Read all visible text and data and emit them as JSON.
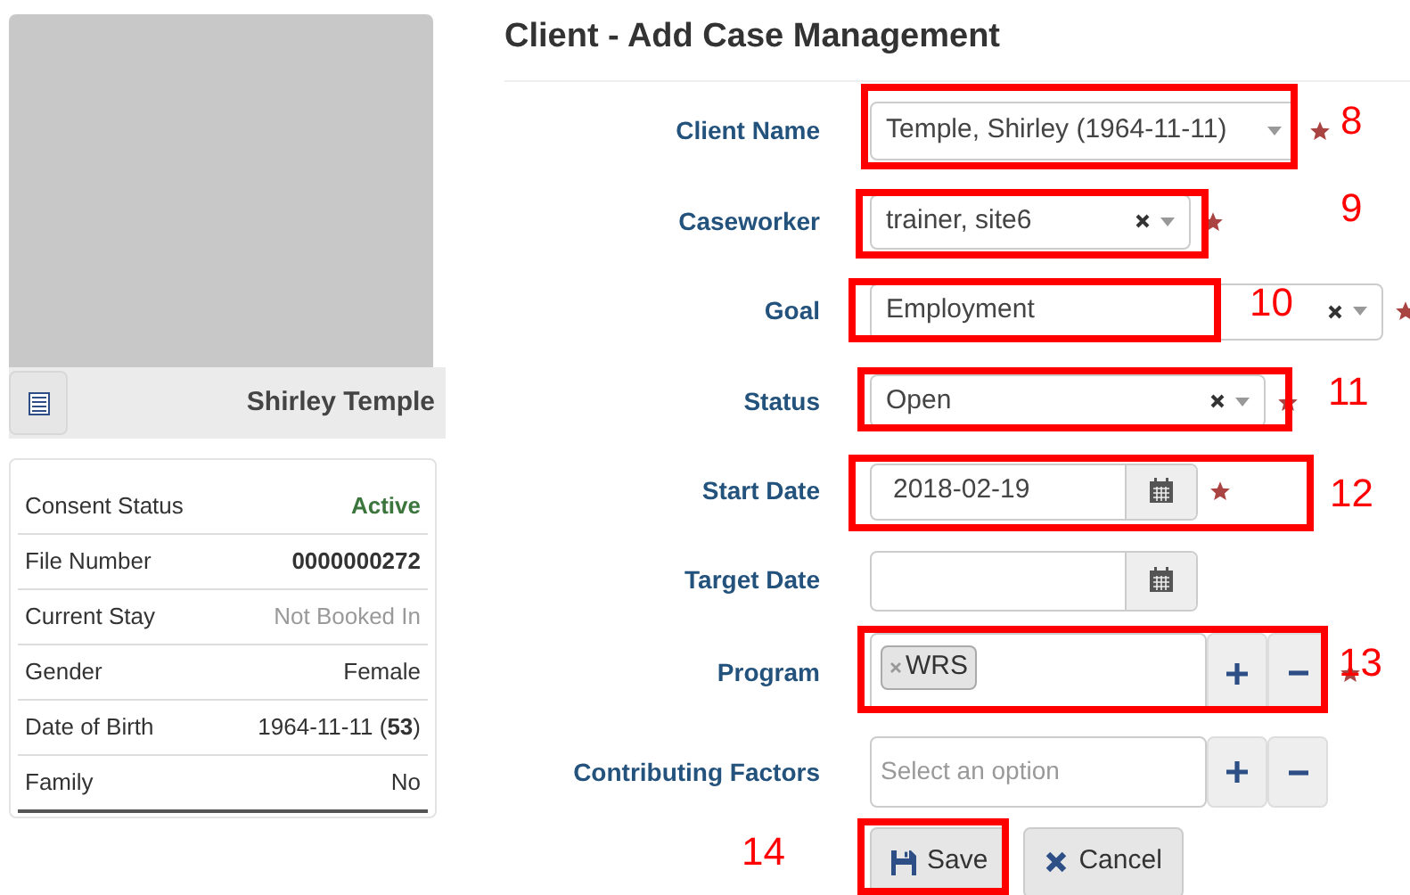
{
  "client_card": {
    "name": "Shirley Temple"
  },
  "info": [
    {
      "label": "Consent Status",
      "value": "Active",
      "kind": "success"
    },
    {
      "label": "File Number",
      "value": "0000000272",
      "kind": "bold"
    },
    {
      "label": "Current Stay",
      "value": "Not Booked In",
      "kind": "muted"
    },
    {
      "label": "Gender",
      "value": "Female",
      "kind": "plain"
    },
    {
      "label": "Date of Birth",
      "value": "1964-11-11 (**53**)",
      "kind": "plain"
    },
    {
      "label": "Family",
      "value": "No",
      "kind": "plain"
    }
  ],
  "title": "Client - Add Case Management",
  "fields": [
    {
      "label": "Client Name",
      "kind": "select",
      "value": "Temple, Shirley (1964-11-11)",
      "clearable": false,
      "required": true
    },
    {
      "label": "Caseworker",
      "kind": "select",
      "value": "trainer, site6",
      "clearable": true,
      "required": true
    },
    {
      "label": "Goal",
      "kind": "select",
      "value": "Employment",
      "clearable": true,
      "required": true
    },
    {
      "label": "Status",
      "kind": "select",
      "value": "Open",
      "clearable": true,
      "required": true
    },
    {
      "label": "Start Date",
      "kind": "date",
      "value": "2018-02-19",
      "required": true
    },
    {
      "label": "Target Date",
      "kind": "date",
      "required": false
    },
    {
      "label": "Program",
      "kind": "multi",
      "tags": [
        "WRS"
      ],
      "required": true
    },
    {
      "label": "Contributing Factors",
      "kind": "multi",
      "placeholder": "Select an option",
      "required": false
    }
  ],
  "buttons": [
    {
      "label": "Save",
      "kind": "save"
    },
    {
      "label": "Cancel",
      "kind": "cancel"
    }
  ],
  "annotations": [
    {
      "number": "8"
    },
    {
      "number": "9"
    },
    {
      "number": "10"
    },
    {
      "number": "11"
    },
    {
      "number": "12"
    },
    {
      "number": "13"
    },
    {
      "number": "14"
    }
  ]
}
